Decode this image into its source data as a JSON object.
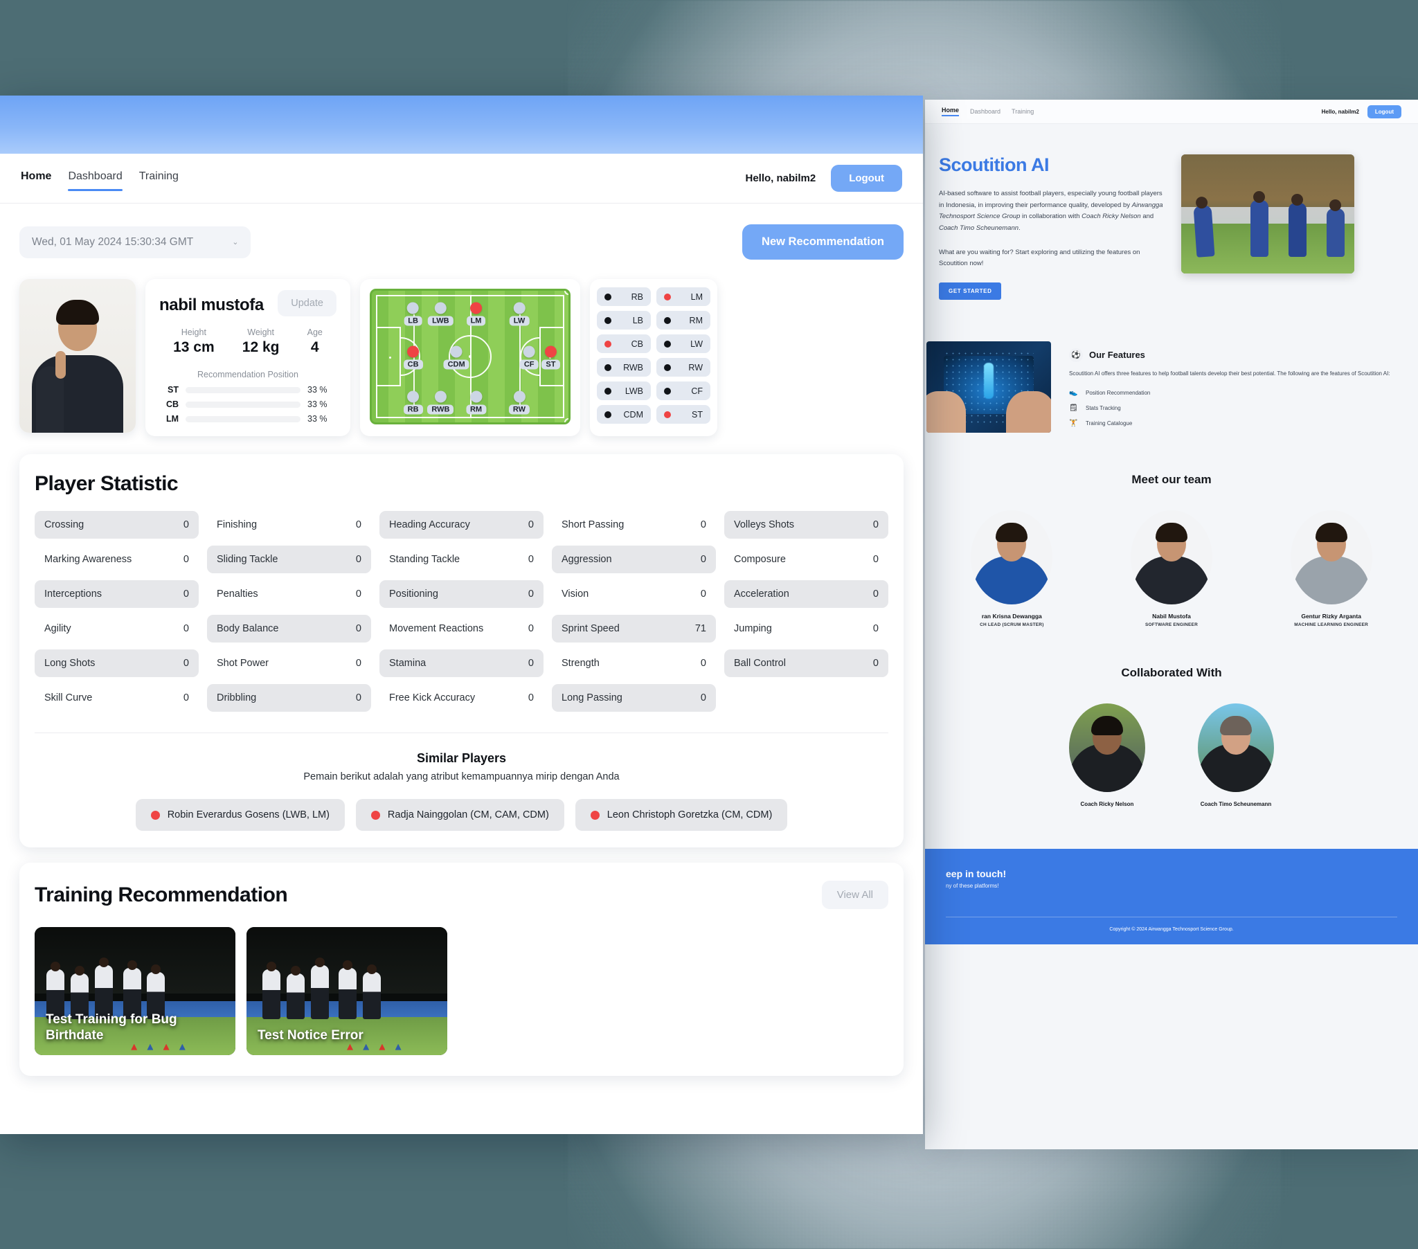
{
  "back_window": {
    "nav": {
      "links": [
        {
          "label": "Home",
          "active": true
        },
        {
          "label": "Dashboard",
          "active": false
        },
        {
          "label": "Training",
          "active": false
        }
      ],
      "hello": "Hello, nabilm2",
      "logout_label": "Logout"
    },
    "hero": {
      "title": "Scoutition AI",
      "paragraph1_a": "AI-based software to assist football players, especially young football players in Indonesia, in improving their performance quality, developed by ",
      "paragraph1_em1": "Airwangga Technosport Science Group",
      "paragraph1_b": " in collaboration with ",
      "paragraph1_em2": "Coach Ricky Nelson",
      "paragraph1_c": " and ",
      "paragraph1_em3": "Coach Timo Scheunemann",
      "paragraph1_d": ".",
      "paragraph2": "What are you waiting for? Start exploring and utilizing the features on Scoutition now!",
      "cta_label": "GET STARTED"
    },
    "features": {
      "badge_icon": "football-icon",
      "title": "Our Features",
      "paragraph": "Scoutition AI offers three features to help football talents develop their best potential. The following are the features of Scoutition AI:",
      "items": [
        {
          "icon": "shoe-icon",
          "label": "Position Recommendation"
        },
        {
          "icon": "document-icon",
          "label": "Stats Tracking"
        },
        {
          "icon": "dumbbell-icon",
          "label": "Training Catalogue"
        }
      ]
    },
    "team": {
      "title": "Meet our team",
      "members": [
        {
          "name": "ran Krisna Dewangga",
          "role": "CH LEAD (SCRUM MASTER)"
        },
        {
          "name": "Nabil Mustofa",
          "role": "SOFTWARE ENGINEER"
        },
        {
          "name": "Gentur Rizky Arganta",
          "role": "MACHINE LEARNING ENGINEER"
        }
      ]
    },
    "collab": {
      "title": "Collaborated With",
      "coaches": [
        {
          "name": "Coach Ricky Nelson"
        },
        {
          "name": "Coach Timo Scheunemann"
        }
      ]
    },
    "footer": {
      "title": "eep in touch!",
      "subtitle": "ny of these platforms!",
      "copyright": "Copyright © 2024 Airwangga Technosport Science Group."
    }
  },
  "front_window": {
    "nav": {
      "links": [
        {
          "label": "Home",
          "active": false
        },
        {
          "label": "Dashboard",
          "active": true
        },
        {
          "label": "Training",
          "active": false
        }
      ],
      "hello": "Hello, nabilm2",
      "logout_label": "Logout"
    },
    "toolbar": {
      "date_value": "Wed, 01 May 2024 15:30:34 GMT",
      "new_recommendation_label": "New Recommendation"
    },
    "player": {
      "name": "nabil mustofa",
      "update_label": "Update",
      "metrics": [
        {
          "label": "Height",
          "value": "13 cm"
        },
        {
          "label": "Weight",
          "value": "12 kg"
        },
        {
          "label": "Age",
          "value": "4"
        }
      ],
      "recommendation_title": "Recommendation Position",
      "recommendations": [
        {
          "position": "ST",
          "percent": "33 %",
          "fill": 33
        },
        {
          "position": "CB",
          "percent": "33 %",
          "fill": 33
        },
        {
          "position": "LM",
          "percent": "33 %",
          "fill": 33
        }
      ]
    },
    "pitch": {
      "markers": [
        {
          "label": "LB",
          "x": 21,
          "y": 18,
          "hot": false
        },
        {
          "label": "LWB",
          "x": 35,
          "y": 18,
          "hot": false
        },
        {
          "label": "LM",
          "x": 53,
          "y": 18,
          "hot": true
        },
        {
          "label": "LW",
          "x": 75,
          "y": 18,
          "hot": false
        },
        {
          "label": "CB",
          "x": 21,
          "y": 51,
          "hot": true
        },
        {
          "label": "CDM",
          "x": 43,
          "y": 51,
          "hot": false
        },
        {
          "label": "CF",
          "x": 80,
          "y": 51,
          "hot": false
        },
        {
          "label": "ST",
          "x": 91,
          "y": 51,
          "hot": true
        },
        {
          "label": "RB",
          "x": 21,
          "y": 85,
          "hot": false
        },
        {
          "label": "RWB",
          "x": 35,
          "y": 85,
          "hot": false
        },
        {
          "label": "RM",
          "x": 53,
          "y": 85,
          "hot": false
        },
        {
          "label": "RW",
          "x": 75,
          "y": 85,
          "hot": false
        }
      ]
    },
    "legend": [
      {
        "label": "RB",
        "hot": false
      },
      {
        "label": "LM",
        "hot": true
      },
      {
        "label": "LB",
        "hot": false
      },
      {
        "label": "RM",
        "hot": false
      },
      {
        "label": "CB",
        "hot": true
      },
      {
        "label": "LW",
        "hot": false
      },
      {
        "label": "RWB",
        "hot": false
      },
      {
        "label": "RW",
        "hot": false
      },
      {
        "label": "LWB",
        "hot": false
      },
      {
        "label": "CF",
        "hot": false
      },
      {
        "label": "CDM",
        "hot": false
      },
      {
        "label": "ST",
        "hot": true
      }
    ],
    "statistics": {
      "title": "Player Statistic",
      "items": [
        {
          "label": "Crossing",
          "value": "0"
        },
        {
          "label": "Finishing",
          "value": "0"
        },
        {
          "label": "Heading Accuracy",
          "value": "0"
        },
        {
          "label": "Short Passing",
          "value": "0"
        },
        {
          "label": "Volleys Shots",
          "value": "0"
        },
        {
          "label": "Marking Awareness",
          "value": "0"
        },
        {
          "label": "Sliding Tackle",
          "value": "0"
        },
        {
          "label": "Standing Tackle",
          "value": "0"
        },
        {
          "label": "Aggression",
          "value": "0"
        },
        {
          "label": "Composure",
          "value": "0"
        },
        {
          "label": "Interceptions",
          "value": "0"
        },
        {
          "label": "Penalties",
          "value": "0"
        },
        {
          "label": "Positioning",
          "value": "0"
        },
        {
          "label": "Vision",
          "value": "0"
        },
        {
          "label": "Acceleration",
          "value": "0"
        },
        {
          "label": "Agility",
          "value": "0"
        },
        {
          "label": "Body Balance",
          "value": "0"
        },
        {
          "label": "Movement Reactions",
          "value": "0"
        },
        {
          "label": "Sprint Speed",
          "value": "71"
        },
        {
          "label": "Jumping",
          "value": "0"
        },
        {
          "label": "Long Shots",
          "value": "0"
        },
        {
          "label": "Shot Power",
          "value": "0"
        },
        {
          "label": "Stamina",
          "value": "0"
        },
        {
          "label": "Strength",
          "value": "0"
        },
        {
          "label": "Ball Control",
          "value": "0"
        },
        {
          "label": "Skill Curve",
          "value": "0"
        },
        {
          "label": "Dribbling",
          "value": "0"
        },
        {
          "label": "Free Kick Accuracy",
          "value": "0"
        },
        {
          "label": "Long Passing",
          "value": "0"
        }
      ]
    },
    "similar_players": {
      "title": "Similar Players",
      "subtitle": "Pemain berikut adalah yang atribut kemampuannya mirip dengan Anda",
      "items": [
        {
          "label": "Robin Everardus Gosens (LWB, LM)"
        },
        {
          "label": "Radja Nainggolan (CM, CAM, CDM)"
        },
        {
          "label": "Leon Christoph Goretzka (CM, CDM)"
        }
      ]
    },
    "training": {
      "title": "Training Recommendation",
      "view_all_label": "View All",
      "cards": [
        {
          "title": "Test Training for Bug Birthdate"
        },
        {
          "title": "Test Notice Error"
        }
      ]
    }
  },
  "colors": {
    "accent_blue": "#4a8af4",
    "button_blue": "#74a8f6",
    "hot_red": "#ef4444",
    "pitch_green": "#7ec24b"
  }
}
